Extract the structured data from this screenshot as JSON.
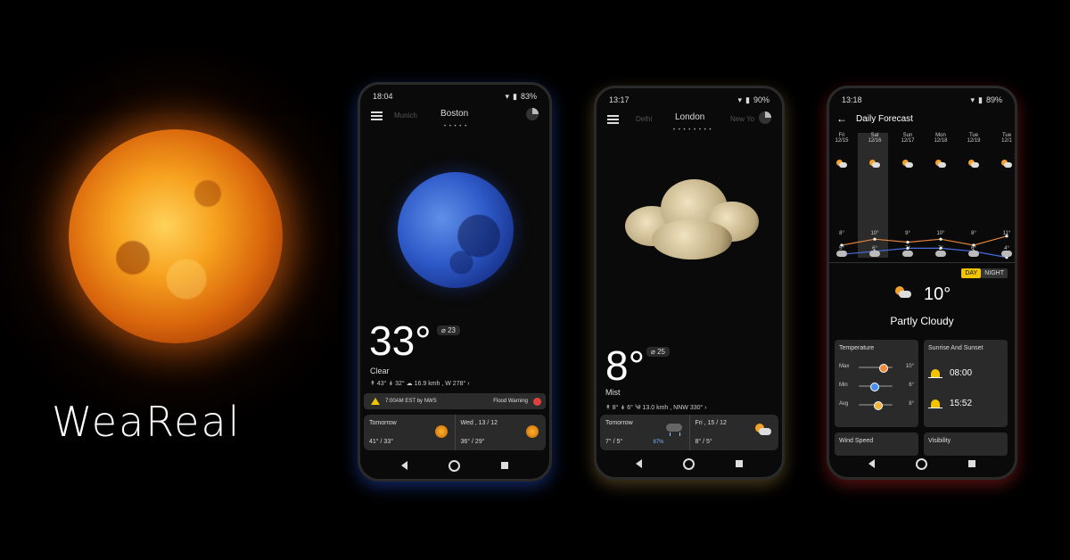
{
  "brand": "WeaReal",
  "phone1": {
    "status": {
      "time": "18:04",
      "battery": "83%"
    },
    "cities": {
      "left": "Munich",
      "current": "Boston"
    },
    "dots": "• • • • •",
    "temp": "33°",
    "aqi": "23",
    "condition": "Clear",
    "details": "↟ 43°   ↡ 32°   ☁ 16.9 kmh , W 278°   ›",
    "warning": {
      "text": "7:00AM EST by NWS",
      "label": "Flood Warning"
    },
    "forecast": [
      {
        "day": "Tomorrow",
        "range": "41° / 33°",
        "icon": "sun-icon"
      },
      {
        "day": "Wed , 13 / 12",
        "range": "36° / 29°",
        "icon": "sun-icon"
      }
    ]
  },
  "phone2": {
    "status": {
      "time": "13:17",
      "battery": "90%"
    },
    "cities": {
      "left": "Delhi",
      "current": "London",
      "right": "New Yo"
    },
    "dots": "• • • • • • • •",
    "temp": "8°",
    "aqi": "25",
    "condition": "Mist",
    "details": "↟ 8°   ↡ 6°   ༄ 13.0 kmh , NNW 330°   ›",
    "forecast": [
      {
        "day": "Tomorrow",
        "range": "7° / 5°",
        "precip": "87%",
        "icon": "rain-cloud-icon"
      },
      {
        "day": "Fri , 15 / 12",
        "range": "8° / 5°",
        "icon": "partly-cloudy-icon"
      }
    ]
  },
  "phone3": {
    "status": {
      "time": "13:18",
      "battery": "89%"
    },
    "title": "Daily Forecast",
    "days": [
      {
        "dow": "Fri",
        "date": "12/15",
        "hi": "8°",
        "lo": "5°",
        "hi_val": 8,
        "lo_val": 5
      },
      {
        "dow": "Sat",
        "date": "12/16",
        "hi": "10°",
        "lo": "6°",
        "hi_val": 10,
        "lo_val": 6
      },
      {
        "dow": "Sun",
        "date": "12/17",
        "hi": "9°",
        "lo": "7°",
        "hi_val": 9,
        "lo_val": 7
      },
      {
        "dow": "Mon",
        "date": "12/18",
        "hi": "10°",
        "lo": "7°",
        "hi_val": 10,
        "lo_val": 7
      },
      {
        "dow": "Tue",
        "date": "12/19",
        "hi": "8°",
        "lo": "6°",
        "hi_val": 8,
        "lo_val": 6
      },
      {
        "dow": "Tue",
        "date": "12/1",
        "hi": "11°",
        "lo": "4°",
        "hi_val": 11,
        "lo_val": 4,
        "precip": "23"
      }
    ],
    "toggle": {
      "day": "DAY",
      "night": "NIGHT"
    },
    "current_temp": "10°",
    "current_cond": "Partly Cloudy",
    "temperature_card": {
      "title": "Temperature",
      "rows": [
        {
          "label": "Max",
          "value": "10°",
          "frac": 0.72,
          "color": "#f28a3c"
        },
        {
          "label": "Min",
          "value": "6°",
          "frac": 0.45,
          "color": "#4a8ef0"
        },
        {
          "label": "Avg",
          "value": "8°",
          "frac": 0.55,
          "color": "#f2b43c"
        }
      ]
    },
    "sun_card": {
      "title": "Sunrise And Sunset",
      "sunrise": "08:00",
      "sunset": "15:52"
    },
    "wind_card": {
      "title": "Wind Speed"
    },
    "visibility_card": {
      "title": "Visibility"
    }
  }
}
